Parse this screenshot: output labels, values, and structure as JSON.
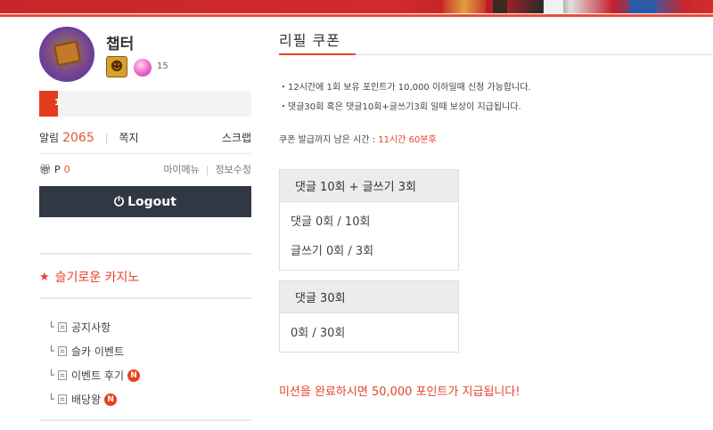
{
  "banner": {
    "accent_color": "#e74c3c"
  },
  "sidebar": {
    "username": "챕터",
    "avatar_text": "",
    "level_number": "15",
    "progress": {
      "label": "1",
      "percent": 9
    },
    "alarm_label": "알림",
    "alarm_count": "2065",
    "memo_label": "쪽지",
    "scrap_label": "스크랩",
    "point_label": "P",
    "point_value": "0",
    "my_menu_label": "마이메뉴",
    "edit_info_label": "정보수정",
    "logout_label": "Logout",
    "menu_title": "슬기로운 카지노",
    "boards": [
      {
        "label": "공지사항",
        "new": false
      },
      {
        "label": "슬카 이벤트",
        "new": false
      },
      {
        "label": "이벤트 후기",
        "new": true,
        "badge": "N"
      },
      {
        "label": "배당왕",
        "new": true,
        "badge": "N"
      }
    ]
  },
  "main": {
    "title": "리필 쿠폰",
    "notices": [
      "・12시간에 1회 보유 포인트가 10,000 이하일때 신청 가능합니다.",
      "・댓글30회 혹은 댓글10회+글쓰기3회 일때 보상이 지급됩니다."
    ],
    "countdown_label": "쿠폰 발급까지 남은 시간 :",
    "countdown_time": "11시간 60분후",
    "mission1": {
      "heading": "댓글 10회 + 글쓰기 3회",
      "line1": "댓글 0회 / 10회",
      "line2": "글쓰기 0회 / 3회"
    },
    "mission2": {
      "heading": "댓글 30회",
      "line1": "0회 / 30회"
    },
    "reward_text": "미션을 완료하시면 50,000 포인트가 지급됩니다!"
  }
}
